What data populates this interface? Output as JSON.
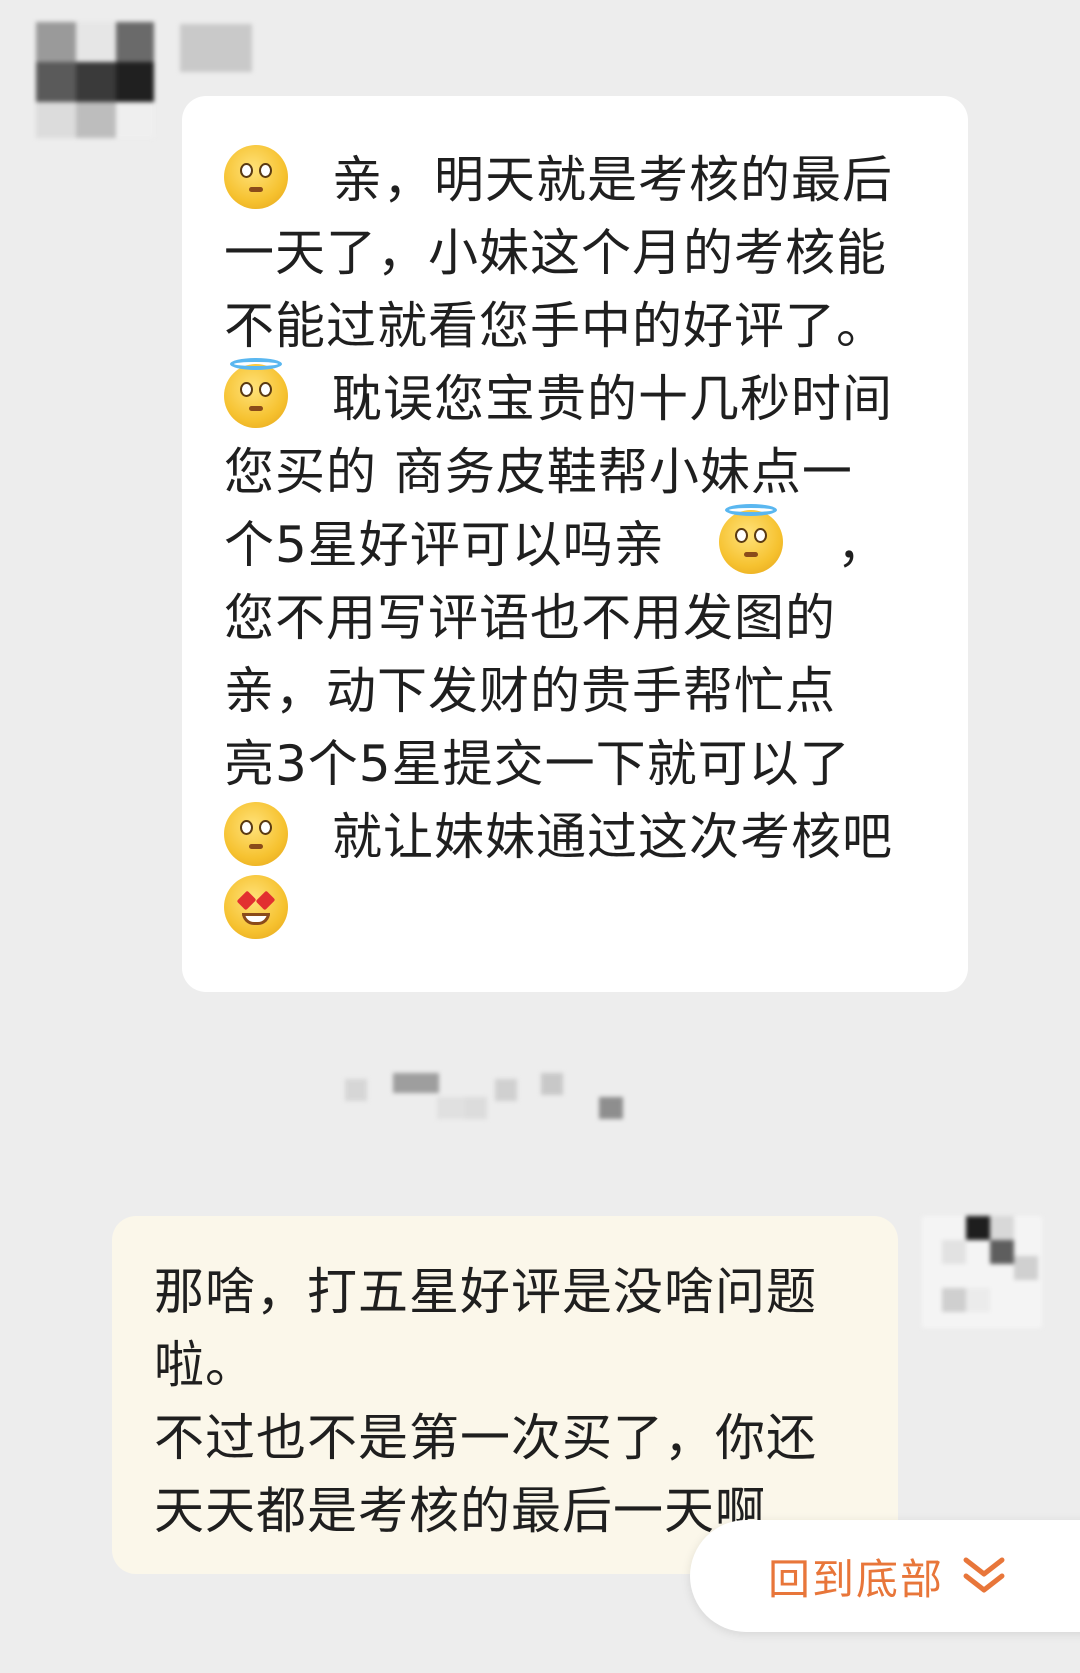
{
  "chat": {
    "incoming": {
      "lines": [
        {
          "emoji": "pleading-face",
          "text": "亲，明天就是考核的最后"
        },
        {
          "text": "一天了，小妹这个月的考核能"
        },
        {
          "text": "不能过就看您手中的好评了。"
        },
        {
          "emoji": "angel-face",
          "text": "耽误您宝贵的十几秒时间"
        },
        {
          "text": "您买的 商务皮鞋帮小妹点一"
        },
        {
          "text": "个5星好评可以吗亲",
          "trailing_emoji": "angel-face",
          "trailing_text": "，"
        },
        {
          "text": "您不用写评语也不用发图的"
        },
        {
          "text": "亲，动下发财的贵手帮忙点"
        },
        {
          "text": "亮3个5星提交一下就可以了"
        },
        {
          "emoji": "pleading-face",
          "text": "就让妹妹通过这次考核吧"
        },
        {
          "emoji": "star-struck-face",
          "text": ""
        }
      ]
    },
    "outgoing": {
      "lines": [
        {
          "text": "那啥，打五星好评是没啥问题"
        },
        {
          "text": "啦。"
        },
        {
          "text": "不过也不是第一次买了，你还"
        },
        {
          "text": "天天都是考核的最后一天啊"
        }
      ]
    }
  },
  "back_to_bottom": {
    "label": "回到底部",
    "icon": "double-chevron-down-icon"
  },
  "colors": {
    "page_bg": "#ededed",
    "incoming_bubble": "#ffffff",
    "outgoing_bubble": "#fbf7ea",
    "accent": "#e8763a"
  }
}
